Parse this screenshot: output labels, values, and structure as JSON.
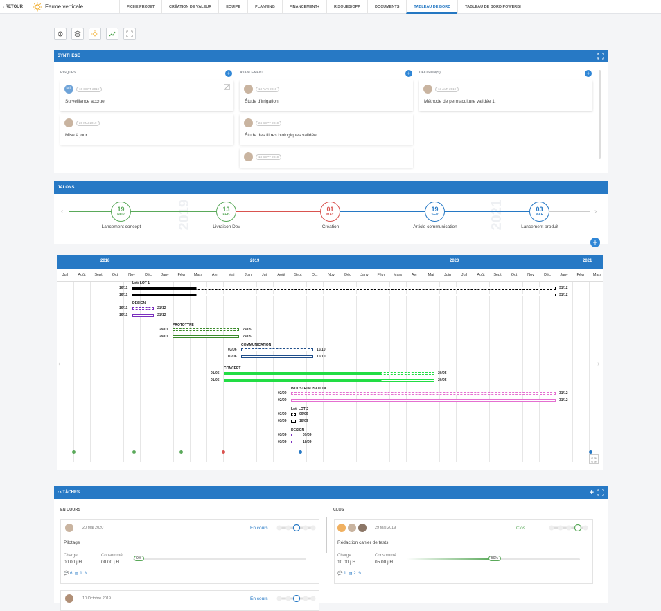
{
  "topbar": {
    "back": "RETOUR",
    "title": "Ferme verticale",
    "tabs": [
      "FICHE PROJET",
      "CRÉATION DE VALEUR",
      "EQUIPE",
      "PLANNING",
      "FINANCEMENT+",
      "RISQUES/OPP",
      "DOCUMENTS",
      "TABLEAU DE BORD",
      "TABLEAU DE BORD POWERBI"
    ],
    "active_tab": "TABLEAU DE BORD"
  },
  "synthese": {
    "title": "SYNTHÈSE",
    "risques": {
      "label": "RISQUES",
      "items": [
        {
          "initials": "ML",
          "date": "10 SEPT 2019",
          "text": "Surveillance accrue"
        },
        {
          "date": "20 MAI 2019",
          "text": "Mise à jour"
        }
      ]
    },
    "avancement": {
      "label": "AVANCEMENT",
      "items": [
        {
          "date": "13 AVR 2019",
          "text": "Étude d'irrigation"
        },
        {
          "date": "24 SEPT 2019",
          "text": "Étude des filtres biologiques validée."
        },
        {
          "date": "18 SEPT 2019",
          "text": ""
        }
      ]
    },
    "decisions": {
      "label": "DÉCISION(S)",
      "items": [
        {
          "date": "13 AVR 2019",
          "text": "Méthode de permaculture validée 1."
        }
      ]
    }
  },
  "jalons": {
    "title": "JALONS",
    "bg_years": [
      "2019",
      "2021"
    ],
    "items": [
      {
        "day": "19",
        "month": "NOV",
        "label": "Lancement concept",
        "color": "#5aa95a"
      },
      {
        "day": "13",
        "month": "FEB",
        "label": "Livraison Dev",
        "color": "#5aa95a"
      },
      {
        "day": "01",
        "month": "MAY",
        "label": "Création",
        "color": "#d9534f"
      },
      {
        "day": "19",
        "month": "SEP",
        "label": "Article communication",
        "color": "#2779c5"
      },
      {
        "day": "03",
        "month": "MAR",
        "label": "Lancement produit",
        "color": "#2779c5"
      }
    ]
  },
  "gantt": {
    "years": [
      "2018",
      "2019",
      "2020",
      "2021"
    ],
    "months": [
      "Juil",
      "Août",
      "Sept",
      "Oct",
      "Nov",
      "Déc",
      "Janv",
      "Févr",
      "Mars",
      "Avr",
      "Mai",
      "Juin",
      "Juil",
      "Août",
      "Sept",
      "Oct",
      "Nov",
      "Déc",
      "Janv",
      "Févr",
      "Mars",
      "Avr",
      "Mai",
      "Juin",
      "Juil",
      "Août",
      "Sept",
      "Oct",
      "Nov",
      "Déc",
      "Janv",
      "Févr",
      "Mars"
    ],
    "rows": [
      {
        "name": "Lot: LOT 1",
        "start": "16/11",
        "end": "31/12",
        "color": "#000000"
      },
      {
        "name": "DESIGN",
        "start": "16/11",
        "end": "21/12",
        "color": "#7b2fbf"
      },
      {
        "name": "PROTOTYPE",
        "start": "29/01",
        "end": "29/05",
        "color": "#3a8a2a"
      },
      {
        "name": "COMMUNICATION",
        "start": "03/06",
        "end": "10/10",
        "color": "#1f4e8a"
      },
      {
        "name": "CONCEPT",
        "start": "01/05",
        "end": "20/05",
        "color": "#22dd44"
      },
      {
        "name": "INDUSTRIALISATION",
        "start": "02/09",
        "end": "31/12",
        "color": "#e46fd0"
      },
      {
        "name": "Lot: LOT 2",
        "start": "03/09",
        "end": "18/09",
        "color": "#000000"
      },
      {
        "name": "DESIGN",
        "start": "03/09",
        "end": "18/09",
        "color": "#7b2fbf"
      }
    ],
    "lot2_mid": "09/09"
  },
  "taches": {
    "title": "TÂCHES",
    "en_cours": {
      "label": "EN COURS",
      "cards": [
        {
          "date": "20 Mai 2020",
          "status": "En cours",
          "name": "Pilotage",
          "charge_label": "Charge",
          "charge": "00.00 j.H",
          "conso_label": "Consommé",
          "conso": "00.00 j.H",
          "pct": "0%",
          "progress": 0,
          "comments": "6",
          "docs": "1"
        },
        {
          "date": "10 Octobre 2019",
          "status": "En cours"
        }
      ]
    },
    "clos": {
      "label": "CLOS",
      "cards": [
        {
          "date": "29 Mai 2019",
          "status": "Clos",
          "name": "Rédaction cahier de tests",
          "charge_label": "Charge",
          "charge": "10.00 j.H",
          "conso_label": "Consommé",
          "conso": "05.00 j.H",
          "pct": "50%",
          "progress": 0.5,
          "comments": "1",
          "docs": "2"
        }
      ]
    }
  }
}
